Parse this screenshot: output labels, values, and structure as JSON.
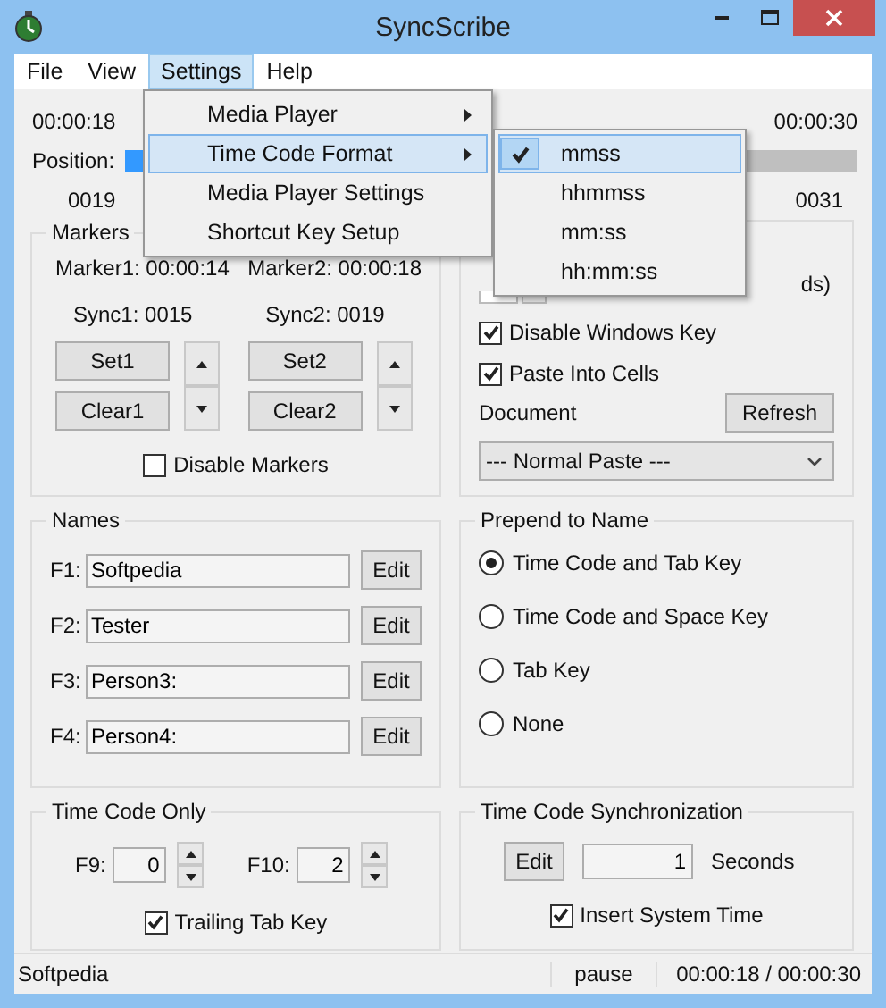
{
  "window": {
    "title": "SyncScribe"
  },
  "menubar": [
    {
      "label": "File",
      "selected": false
    },
    {
      "label": "View",
      "selected": false
    },
    {
      "label": "Settings",
      "selected": true
    },
    {
      "label": "Help",
      "selected": false
    }
  ],
  "menu": [
    {
      "label": "Media Player",
      "submenu": true,
      "highlighted": false
    },
    {
      "label": "Time Code Format",
      "submenu": true,
      "highlighted": true
    },
    {
      "label": "Media Player Settings",
      "submenu": false,
      "highlighted": false
    },
    {
      "label": "Shortcut Key Setup",
      "submenu": false,
      "highlighted": false
    }
  ],
  "submenu": [
    {
      "label": "mmss",
      "checked": true,
      "highlighted": true
    },
    {
      "label": "hhmmss",
      "checked": false,
      "highlighted": false
    },
    {
      "label": "mm:ss",
      "checked": false,
      "highlighted": false
    },
    {
      "label": "hh:mm:ss",
      "checked": false,
      "highlighted": false
    }
  ],
  "player": {
    "elapsed": "00:00:18",
    "total": "00:00:30",
    "position_label": "Position:",
    "level": 0.6,
    "frame_start": "0019",
    "frame_end": "0031"
  },
  "markers": {
    "title": "Markers",
    "marker1": "Marker1: 00:00:14",
    "marker2": "Marker2: 00:00:18",
    "sync1": "Sync1: 0015",
    "sync2": "Sync2: 0019",
    "set1": "Set1",
    "clear1": "Clear1",
    "set2": "Set2",
    "clear2": "Clear2",
    "disable": {
      "label": "Disable Markers",
      "checked": false
    }
  },
  "options": {
    "partial_text": "ds)",
    "checkboxes": [
      {
        "label": "Disable Windows Key",
        "checked": true
      },
      {
        "label": "Paste Into Cells",
        "checked": true
      }
    ],
    "document_label": "Document",
    "refresh": "Refresh",
    "dropdown": "--- Normal Paste ---"
  },
  "names": {
    "title": "Names",
    "rows": [
      {
        "label": "F1:",
        "value": "Softpedia",
        "button": "Edit"
      },
      {
        "label": "F2:",
        "value": "Tester",
        "button": "Edit"
      },
      {
        "label": "F3:",
        "value": "Person3:",
        "button": "Edit"
      },
      {
        "label": "F4:",
        "value": "Person4:",
        "button": "Edit"
      }
    ]
  },
  "prepend": {
    "title": "Prepend to Name",
    "options": [
      {
        "label": "Time Code and Tab Key",
        "selected": true
      },
      {
        "label": "Time Code and Space Key",
        "selected": false
      },
      {
        "label": "Tab Key",
        "selected": false
      },
      {
        "label": "None",
        "selected": false
      }
    ]
  },
  "time_code_only": {
    "title": "Time Code Only",
    "f9_label": "F9:",
    "f9_value": "0",
    "f10_label": "F10:",
    "f10_value": "2",
    "trailing": {
      "label": "Trailing Tab Key",
      "checked": true
    }
  },
  "sync": {
    "title": "Time Code Synchronization",
    "edit": "Edit",
    "value": "1",
    "unit": "Seconds",
    "insert": {
      "label": "Insert System Time",
      "checked": true
    }
  },
  "status_bar": {
    "text": "Softpedia",
    "state": "pause",
    "time": "00:00:18 / 00:00:30"
  }
}
